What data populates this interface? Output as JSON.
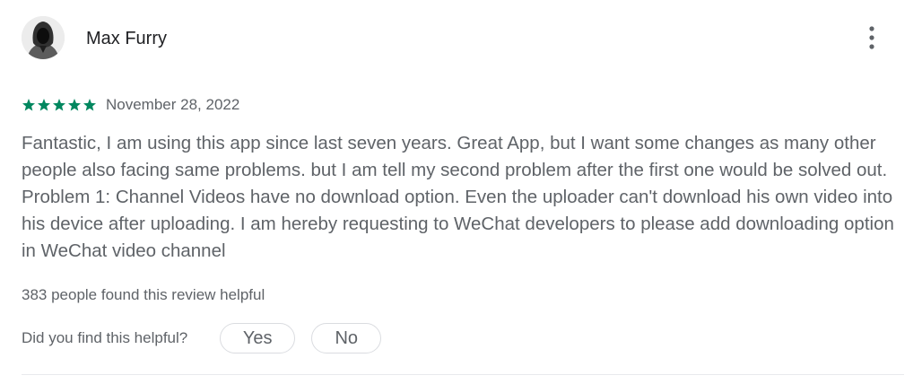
{
  "review": {
    "author": "Max Furry",
    "avatar_icon": "hooded-person-avatar",
    "menu_icon": "more-vert-icon",
    "rating": 5,
    "rating_max": 5,
    "star_color": "#01875f",
    "date": "November 28, 2022",
    "body": "Fantastic, I am using this app since last seven years. Great App, but I want some changes as many other people also facing same problems. but I am tell my second problem after the first one would be solved out. Problem 1: Channel Videos have no download option. Even the uploader can't download his own video into his device after uploading. I am hereby requesting to WeChat developers to please add downloading option in WeChat video channel",
    "helpful_count_text": "383 people found this review helpful",
    "helpful_question": "Did you find this helpful?",
    "yes_label": "Yes",
    "no_label": "No"
  }
}
